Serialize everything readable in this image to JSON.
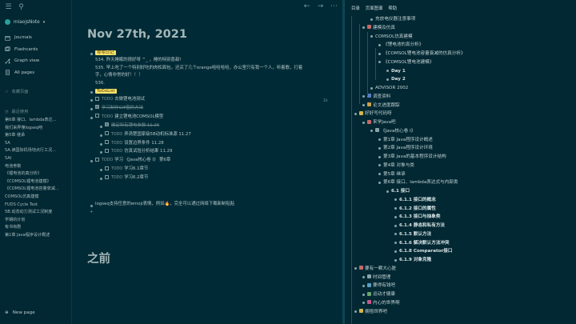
{
  "sidebar": {
    "workspace": "miaojsNote",
    "nav": [
      "Journals",
      "Flashcards",
      "Graph view",
      "All pages"
    ],
    "favorites_label": "收藏页面",
    "recent_label": "最近使用",
    "recent": [
      "第6章 接口、lambda表达...",
      "我们来弄懂logseq吧",
      "第5章 继承",
      "5A",
      "5A.读国际机场地点行工况...",
      "5AI",
      "电池参数",
      "《锂电池的真分析》",
      "《COMSOL锂电池建模》",
      "《COMSOL锂电池容量衰减...",
      "COMSOL仿真建模",
      "FUDS Cycle Test",
      "5B.动态动力测试工况制度",
      "学期的计划",
      "有书有剧",
      "第1章 Java程序设计概述"
    ],
    "new_page": "New page"
  },
  "main": {
    "title": "Nov 27th, 2021",
    "title2": "之前",
    "diary_tag": "零零日记",
    "diary_lines": [
      "534. 昨天睡眠的很好呀 ^_ ，睡的特别香甜!",
      "535. 早上吃了一个特别好吃的肉松面包，还买了几个orange哈哈哈哈，办公室只有我一个人，听着歌，打着",
      "字，心情非常的好！！！",
      "536."
    ],
    "todolist_tag": "ToDoList",
    "todo_kw": "TODO",
    "done_kw": "DONE",
    "todo_tag_hint": "1k",
    "todos": [
      {
        "level": 1,
        "kw": "TODO",
        "text": "去做锂电池测试"
      },
      {
        "level": 1,
        "kw": "DONE",
        "text": "学习制作GIF图的方法",
        "done": true
      },
      {
        "level": 1,
        "kw": "TODO",
        "text": "建立锂电池COMSOL模型"
      },
      {
        "level": 2,
        "kw": "DONE",
        "text": "确定所有锂电参数 11.25",
        "done": true
      },
      {
        "level": 2,
        "kw": "TODO",
        "text": "弄清楚国家级5B动机标准源 11.27"
      },
      {
        "level": 2,
        "kw": "TODO",
        "text": "设置边界条件 11.28"
      },
      {
        "level": 2,
        "kw": "TODO",
        "text": "仿真试验分析结果 11.29"
      },
      {
        "level": 1,
        "kw": "TODO",
        "text": "学习 《Java核心卷 I》 第6章"
      },
      {
        "level": 2,
        "kw": "TODO",
        "text": "学习6.1章节"
      },
      {
        "level": 2,
        "kw": "TODO",
        "text": "学习6.2章节"
      }
    ],
    "emoji_line": "logseq支持任意的emoji表情，例如🔥，完全可以通过网络下载新制贴贴"
  },
  "right": {
    "tabs": [
      "目录",
      "页面图谱",
      "帮助"
    ],
    "items": [
      {
        "d": 3,
        "t": "充放电仪器注意事项"
      },
      {
        "d": 2,
        "t": "建模及仿真",
        "emo": "#c56a6a"
      },
      {
        "d": 3,
        "t": "COMSOL仿真建模"
      },
      {
        "d": 4,
        "t": "《锂电池的真分析》"
      },
      {
        "d": 4,
        "t": "《COMSOL锂电池容量衰减的仿真分析》"
      },
      {
        "d": 4,
        "t": "《COMSOL锂电池建模》"
      },
      {
        "d": 5,
        "t": "Day 1",
        "b": true
      },
      {
        "d": 5,
        "t": "Day 2",
        "b": true
      },
      {
        "d": 3,
        "t": "ADVISOR 2002"
      },
      {
        "d": 2,
        "t": "调查资料",
        "emo": "#5a7fc4"
      },
      {
        "d": 2,
        "t": "论文进度跟踪",
        "emo": "#c9a24a"
      },
      {
        "d": 1,
        "t": "好好写代码呀",
        "emo": "#d4b54a"
      },
      {
        "d": 2,
        "t": "来学Java吧",
        "emo": "#c56a6a"
      },
      {
        "d": 3,
        "t": "《Java核心卷 I》",
        "emo": "#8aa4a8"
      },
      {
        "d": 4,
        "t": "第1章 Java程序设计概述"
      },
      {
        "d": 4,
        "t": "第2章 Java程序设计环境"
      },
      {
        "d": 4,
        "t": "第3章 Java的基本程序设计结构"
      },
      {
        "d": 4,
        "t": "第4章 对象与类"
      },
      {
        "d": 4,
        "t": "第5章 继承"
      },
      {
        "d": 4,
        "t": "第6章 接口、lambda表达式与内部类"
      },
      {
        "d": 5,
        "t": "6.1 接口",
        "b": true
      },
      {
        "d": 6,
        "t": "6.1.1 接口的概念",
        "b": true
      },
      {
        "d": 6,
        "t": "6.1.2 接口的属性",
        "b": true
      },
      {
        "d": 6,
        "t": "6.1.3 接口与抽象类",
        "b": true
      },
      {
        "d": 6,
        "t": "6.1.4 静态和私有方法",
        "b": true
      },
      {
        "d": 6,
        "t": "6.1.5 默认方法",
        "b": true
      },
      {
        "d": 6,
        "t": "6.1.6 解决默认方法冲突",
        "b": true
      },
      {
        "d": 6,
        "t": "6.1.8 Comparator接口",
        "b": true
      },
      {
        "d": 6,
        "t": "6.1.9 对象克隆",
        "b": true
      },
      {
        "d": 1,
        "t": "要有一颗大心脏",
        "emo": "#c56a6a"
      },
      {
        "d": 2,
        "t": "时间管理",
        "emo": "#8aa4a8"
      },
      {
        "d": 2,
        "t": "要得有钱吧",
        "emo": "#5a9fc4"
      },
      {
        "d": 2,
        "t": "运动才健康",
        "emo": "#6aa46a"
      },
      {
        "d": 2,
        "t": "内心的世界啊",
        "emo": "#c55a8a"
      },
      {
        "d": 1,
        "t": "拥抱世界吧",
        "emo": "#d4b54a"
      }
    ]
  }
}
